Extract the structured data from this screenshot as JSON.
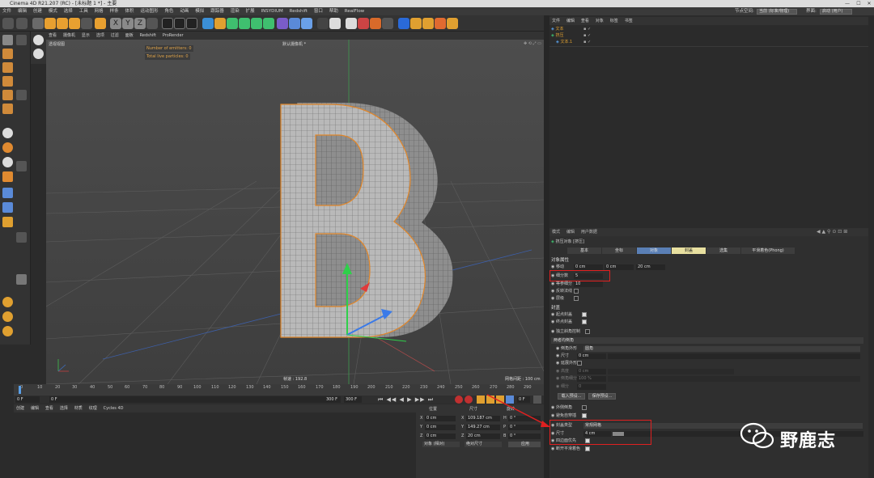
{
  "window": {
    "title": "Cinema 4D R21.207 (RC) - [未标题 1 *] - 主要"
  },
  "menubar": {
    "items": [
      "文件",
      "编辑",
      "创建",
      "模式",
      "选择",
      "工具",
      "网格",
      "样条",
      "体积",
      "运动图形",
      "角色",
      "动画",
      "模拟",
      "跟踪器",
      "渲染",
      "扩展",
      "INSYDIUM",
      "Redshift",
      "窗口",
      "帮助",
      "RealFlow"
    ],
    "node_space_label": "节点空间:",
    "node_space_value": "当前 (标准/物理)",
    "interface_label": "界面:",
    "interface_value": "启动 (用户)"
  },
  "viewport": {
    "menu": [
      "查看",
      "摄像机",
      "显示",
      "选项",
      "过滤",
      "面板",
      "Redshift",
      "ProRender"
    ],
    "label": "透视视图",
    "camera_label": "默认摄像机 *",
    "hud_emitters": "Number of emitters: 0",
    "hud_particles": "Total live particles: 0",
    "speed": "帧速 : 192.8",
    "grid_spacing": "网格间距 : 100 cm",
    "object_letter": "B"
  },
  "timeline": {
    "ticks": [
      "0",
      "10",
      "20",
      "30",
      "40",
      "50",
      "60",
      "70",
      "80",
      "90",
      "100",
      "110",
      "120",
      "130",
      "140",
      "150",
      "160",
      "170",
      "180",
      "190",
      "200",
      "210",
      "220",
      "230",
      "240",
      "250",
      "260",
      "270",
      "280",
      "290"
    ],
    "current_frame": "0 F",
    "start": "0 F",
    "end_1": "300 F",
    "end_2": "300 F",
    "end_field": "0 F"
  },
  "material_menu": [
    "创建",
    "编辑",
    "查看",
    "选择",
    "材质",
    "纹理",
    "Cycles 4D"
  ],
  "coords": {
    "headers": [
      "位置",
      "尺寸",
      "旋转"
    ],
    "rows": [
      {
        "axis": "X",
        "pos": "0 cm",
        "axis2": "X",
        "size": "109.187 cm",
        "axis3": "H",
        "rot": "0 °"
      },
      {
        "axis": "Y",
        "pos": "0 cm",
        "axis2": "Y",
        "size": "149.27 cm",
        "axis3": "P",
        "rot": "0 °"
      },
      {
        "axis": "Z",
        "pos": "0 cm",
        "axis2": "Z",
        "size": "20 cm",
        "axis3": "B",
        "rot": "0 °"
      }
    ],
    "mode_1": "对象 (相对)",
    "mode_2": "绝对尺寸",
    "apply": "应用"
  },
  "objmgr": {
    "menu": [
      "文件",
      "编辑",
      "查看",
      "对象",
      "标签",
      "书签"
    ],
    "rows": [
      {
        "name": "文本"
      },
      {
        "name": "挤压"
      },
      {
        "name": "文本.1"
      }
    ]
  },
  "attr": {
    "menu": [
      "模式",
      "编辑",
      "用户数据"
    ],
    "object_title": "挤压对象 [挤压]",
    "tabs": [
      "基本",
      "坐标",
      "对象",
      "封盖",
      "选集",
      "平滑着色(Phong)"
    ],
    "section_object": "对象属性",
    "move_label": "移动",
    "move_x": "0 cm",
    "move_y": "0 cm",
    "move_z": "20 cm",
    "subdiv_label": "细分数",
    "subdiv_value": "5",
    "iso_label": "等参细分",
    "iso_value": "10",
    "reverse_label": "反转法线",
    "hier_label": "层级",
    "section_caps": "封盖",
    "start_cap": "起点封盖",
    "end_cap": "终点封盖",
    "sep_bevel": "独立斜角控制",
    "bevel_group": "两者均倒角",
    "bevel_shape_label": "倒角外形",
    "bevel_shape_value": "圆角",
    "size_label": "尺寸",
    "size_value": "0 cm",
    "extend_shape": "延展外形",
    "height_label": "高度",
    "height_value": "0 cm",
    "subdiv2_label": "倒角细分",
    "subdiv2_value": "100 %",
    "sub_label": "细分",
    "sub_value": "0",
    "load_preset": "载入预设...",
    "save_preset": "保存预设...",
    "outer_bevel": "外侧倒角",
    "avoid_self": "避免自穿插",
    "cap_type_label": "封盖类型",
    "cap_type_value": "常规网格",
    "cap_size_label": "尺寸",
    "cap_size_value": "4 cm",
    "quad_label": "四边面优先",
    "break_phong": "断开平滑着色"
  },
  "watermark": {
    "text": "野鹿志"
  }
}
